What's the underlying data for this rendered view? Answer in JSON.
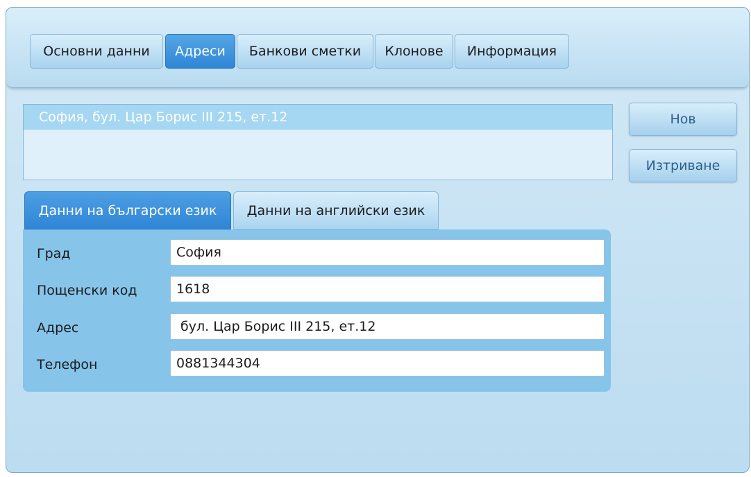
{
  "tabs": [
    {
      "label": "Основни данни"
    },
    {
      "label": "Адреси"
    },
    {
      "label": "Банкови сметки"
    },
    {
      "label": "Клонове"
    },
    {
      "label": "Информация"
    }
  ],
  "active_tab": "Адреси",
  "address_list": {
    "items": [
      "София,  бул. Цар Борис III 215, ет.12"
    ]
  },
  "buttons": {
    "new_label": "Нов",
    "delete_label": "Изтриване"
  },
  "language_tabs": [
    {
      "label": "Данни на български език"
    },
    {
      "label": "Данни на английски език"
    }
  ],
  "active_language_tab": "Данни на български език",
  "form": {
    "fields": [
      {
        "label": "Град",
        "value": "София"
      },
      {
        "label": "Пощенски код",
        "value": "1618"
      },
      {
        "label": "Адрес",
        "value": " бул. Цар Борис III 215, ет.12"
      },
      {
        "label": "Телефон",
        "value": "0881344304"
      }
    ]
  },
  "colors": {
    "accent": "#2e86d6",
    "panel": "#86c4ea",
    "background": "#c4e2f3"
  }
}
